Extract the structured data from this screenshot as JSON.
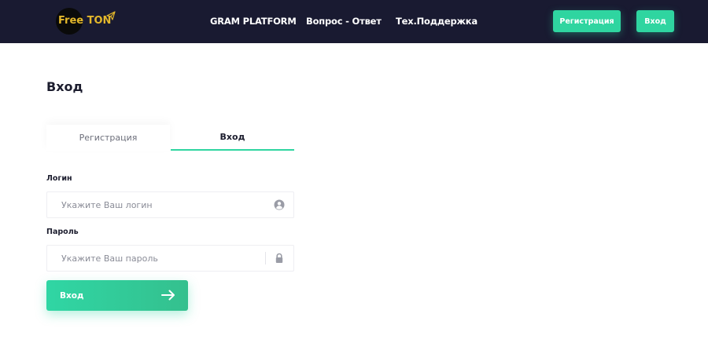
{
  "header": {
    "logo": {
      "brand": "Free TON",
      "icon": "paper-plane-icon"
    },
    "nav": [
      "GRAM PLATFORM",
      "Вопрос - Ответ",
      "Тех.Поддержка"
    ],
    "register_button": "Регистрация",
    "login_button": "Вход"
  },
  "page": {
    "title": "Вход"
  },
  "tabs": [
    {
      "label": "Регистрация",
      "active": false
    },
    {
      "label": "Вход",
      "active": true
    }
  ],
  "form": {
    "login": {
      "label": "Логин",
      "placeholder": "Укажите Ваш логин",
      "value": "",
      "icon": "user-circle-icon"
    },
    "password": {
      "label": "Пароль",
      "placeholder": "Укажите Ваш пароль",
      "value": "",
      "icon": "lock-icon"
    },
    "submit": {
      "label": "Вход",
      "icon": "arrow-right-icon"
    }
  },
  "colors": {
    "header_bg": "#191a31",
    "accent": "#2fd5a0",
    "logo": "#e3b72b"
  }
}
